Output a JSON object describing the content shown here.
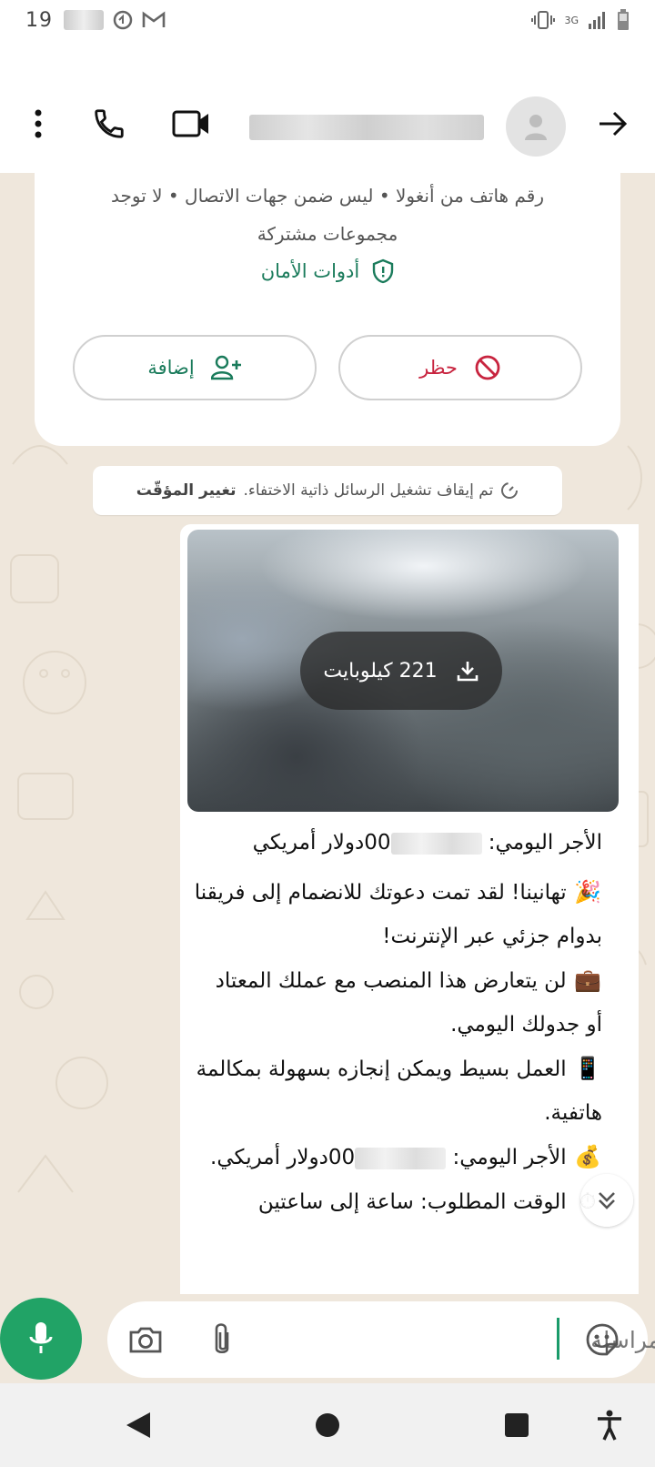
{
  "status_bar": {
    "time": "19",
    "network": "3G"
  },
  "header": {
    "contact_name": "",
    "icons": [
      "more-vert-icon",
      "phone-icon",
      "video-call-icon",
      "avatar",
      "forward-arrow-icon"
    ]
  },
  "info_card": {
    "details": "رقم هاتف من أنغولا • ليس ضمن جهات الاتصال • لا توجد مجموعات مشتركة",
    "safety_tools": "أدوات الأمان",
    "block_label": "حظر",
    "add_label": "إضافة"
  },
  "system_note": {
    "text": "تم إيقاف تشغيل الرسائل ذاتية الاختفاء.",
    "action": "تغيير المؤقّت"
  },
  "message": {
    "media_size": "221 كيلوبايت",
    "lines": {
      "wage_prefix": "الأجر اليومي: ",
      "wage_suffix_hidden": "00",
      "wage_currency": "دولار أمريكي",
      "congrats": "تهانينا! لقد تمت دعوتك للانضمام إلى فريقنا بدوام جزئي عبر الإنترنت!",
      "no_conflict": "لن يتعارض هذا المنصب مع عملك المعتاد أو جدولك اليومي.",
      "simple_work": "العمل بسيط ويمكن إنجازه بسهولة بمكالمة هاتفية.",
      "wage2_prefix": "الأجر اليومي: ",
      "wage2_suffix_hidden": "00",
      "wage2_currency": "دولار أمريكي.",
      "time_required": "الوقت المطلوب: ساعة إلى ساعتين"
    },
    "emojis": {
      "party": "🎉",
      "briefcase": "💼",
      "phone": "📱",
      "money_bag": "💰",
      "stopwatch": "⏱"
    }
  },
  "composer": {
    "placeholder": "مراسلة",
    "value": ""
  },
  "colors": {
    "accent_green": "#1a7b5b",
    "mic_green": "#21a366",
    "block_red": "#c8243f",
    "chat_bg": "#efe7dc"
  }
}
